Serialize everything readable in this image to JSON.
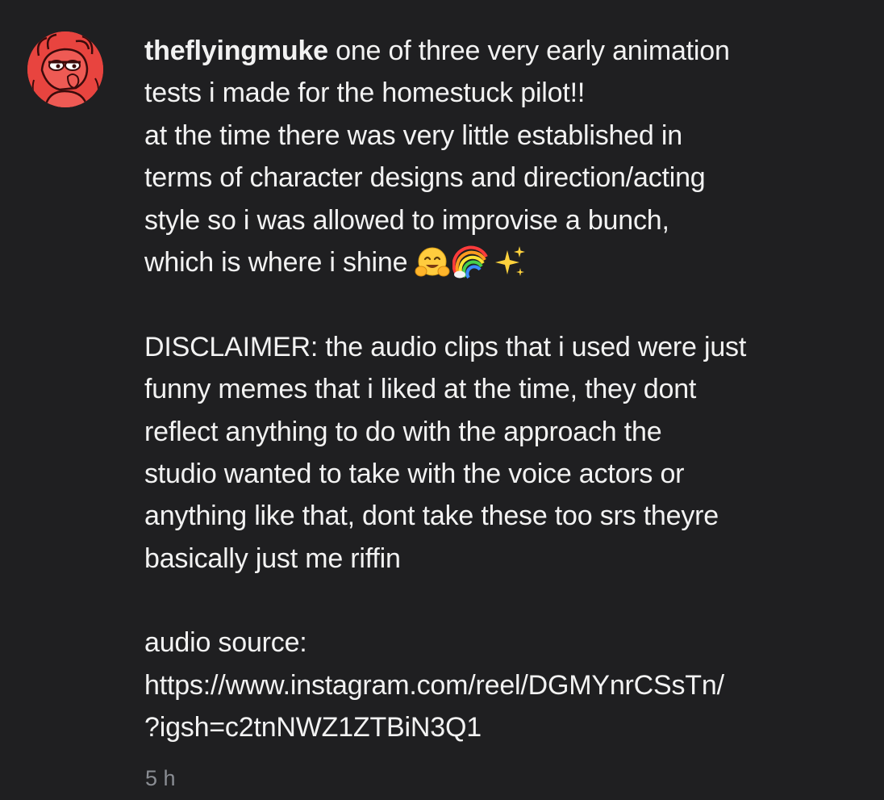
{
  "comment": {
    "username": "theflyingmuke",
    "avatar_icon": "avatar-cartoon-character",
    "avatar_color": "#e8443f",
    "first_line_text": "one of three very early animation",
    "lines": [
      "tests i made for the homestuck pilot!!",
      "at the time there was very little established in",
      "terms of character designs and direction/acting",
      "style so i was allowed to improvise a bunch,"
    ],
    "shine_line": "which is where i shine",
    "emojis": [
      "hugging-face-emoji",
      "rainbow-emoji",
      "sparkles-emoji"
    ],
    "disclaimer_lines": [
      "DISCLAIMER: the audio clips that i used were just",
      "funny memes that i liked at the time, they dont",
      "reflect anything to do with the approach the",
      "studio wanted to take with the voice actors or",
      "anything like that, dont take these too srs theyre",
      "basically just me riffin"
    ],
    "source_lines": [
      "audio source:",
      "https://www.instagram.com/reel/DGMYnrCSsTn/",
      "?igsh=c2tnNWZ1ZTBiN3Q1"
    ],
    "timestamp": "5 h"
  },
  "colors": {
    "background": "#1f1f21",
    "text": "#f2f2f2",
    "timestamp": "#8a8d93"
  }
}
